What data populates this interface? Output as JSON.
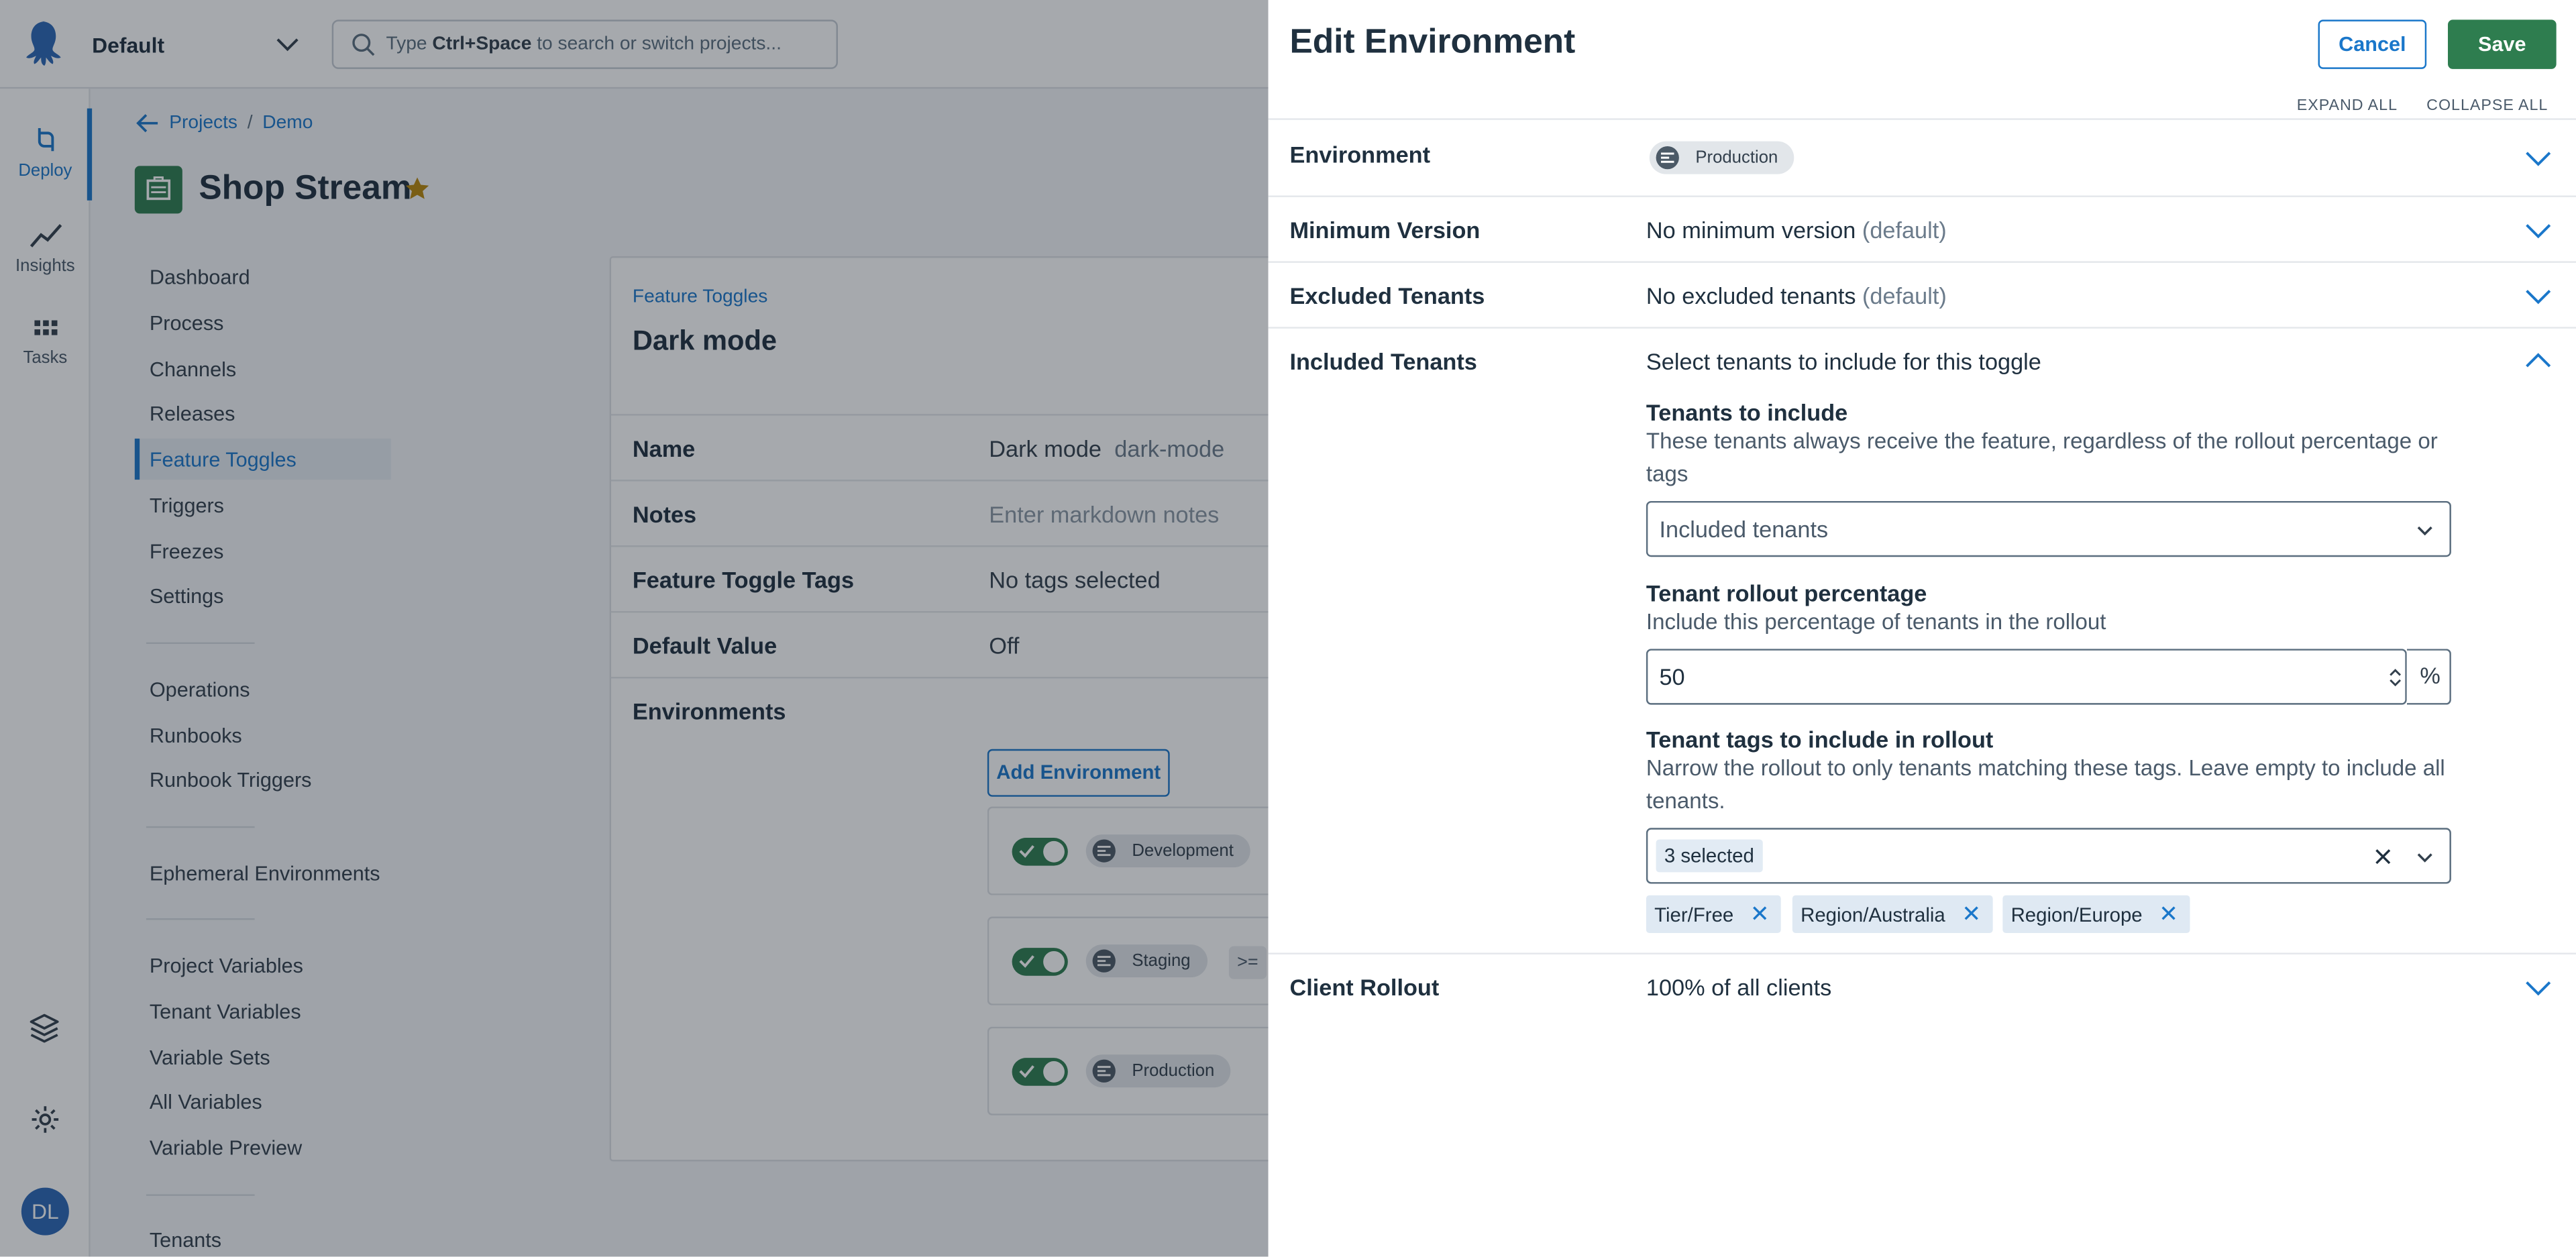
{
  "topbar": {
    "space_name": "Default",
    "search_placeholder_prefix": "Type",
    "search_placeholder_key": "Ctrl+Space",
    "search_placeholder_suffix": "to search or switch projects..."
  },
  "rail": {
    "items": [
      {
        "label": "Deploy",
        "icon": "deploy-icon"
      },
      {
        "label": "Insights",
        "icon": "insights-icon"
      },
      {
        "label": "Tasks",
        "icon": "tasks-icon"
      }
    ],
    "avatar_initials": "DL"
  },
  "breadcrumb": {
    "projects": "Projects",
    "separator": "/",
    "project_group": "Demo"
  },
  "project": {
    "title": "Shop Stream"
  },
  "nav": {
    "group1": [
      "Dashboard",
      "Process",
      "Channels",
      "Releases",
      "Feature Toggles",
      "Triggers",
      "Freezes",
      "Settings"
    ],
    "group2": [
      "Operations",
      "Runbooks",
      "Runbook Triggers"
    ],
    "group3": [
      "Ephemeral Environments"
    ],
    "group4": [
      "Project Variables",
      "Tenant Variables",
      "Variable Sets",
      "All Variables",
      "Variable Preview"
    ],
    "group5": [
      "Tenants"
    ]
  },
  "toggle": {
    "breadcrumb": "Feature Toggles",
    "title": "Dark mode",
    "name_label": "Name",
    "name_value": "Dark mode",
    "name_slug": "dark-mode",
    "notes_label": "Notes",
    "notes_placeholder": "Enter markdown notes",
    "tags_label": "Feature Toggle Tags",
    "tags_value": "No tags selected",
    "default_label": "Default Value",
    "default_value": "Off",
    "environments_label": "Environments",
    "add_env_button": "Add Environment",
    "environments": [
      {
        "name": "Development",
        "enabled": true
      },
      {
        "name": "Staging",
        "enabled": true,
        "extra": ">="
      },
      {
        "name": "Production",
        "enabled": true
      }
    ]
  },
  "drawer": {
    "title": "Edit Environment",
    "cancel": "Cancel",
    "save": "Save",
    "expand_all": "EXPAND ALL",
    "collapse_all": "COLLAPSE ALL",
    "environment_label": "Environment",
    "environment_value": "Production",
    "min_version_label": "Minimum Version",
    "min_version_value": "No minimum version",
    "min_version_default": "(default)",
    "excluded_label": "Excluded Tenants",
    "excluded_value": "No excluded tenants",
    "excluded_default": "(default)",
    "included_label": "Included Tenants",
    "included_summary": "Select tenants to include for this toggle",
    "tenants_to_include_title": "Tenants to include",
    "tenants_to_include_desc": "These tenants always receive the feature, regardless of the rollout percentage or tags",
    "included_tenants_placeholder": "Included tenants",
    "rollout_title": "Tenant rollout percentage",
    "rollout_desc": "Include this percentage of tenants in the rollout",
    "rollout_value": "50",
    "rollout_unit": "%",
    "tags_title": "Tenant tags to include in rollout",
    "tags_desc": "Narrow the rollout to only tenants matching these tags. Leave empty to include all tenants.",
    "tags_selected": "3 selected",
    "tags": [
      "Tier/Free",
      "Region/Australia",
      "Region/Europe"
    ],
    "client_rollout_label": "Client Rollout",
    "client_rollout_value": "100% of all clients"
  },
  "colors": {
    "accent": "#1a77ca",
    "success": "#2e7d4f",
    "text": "#1f303f"
  }
}
